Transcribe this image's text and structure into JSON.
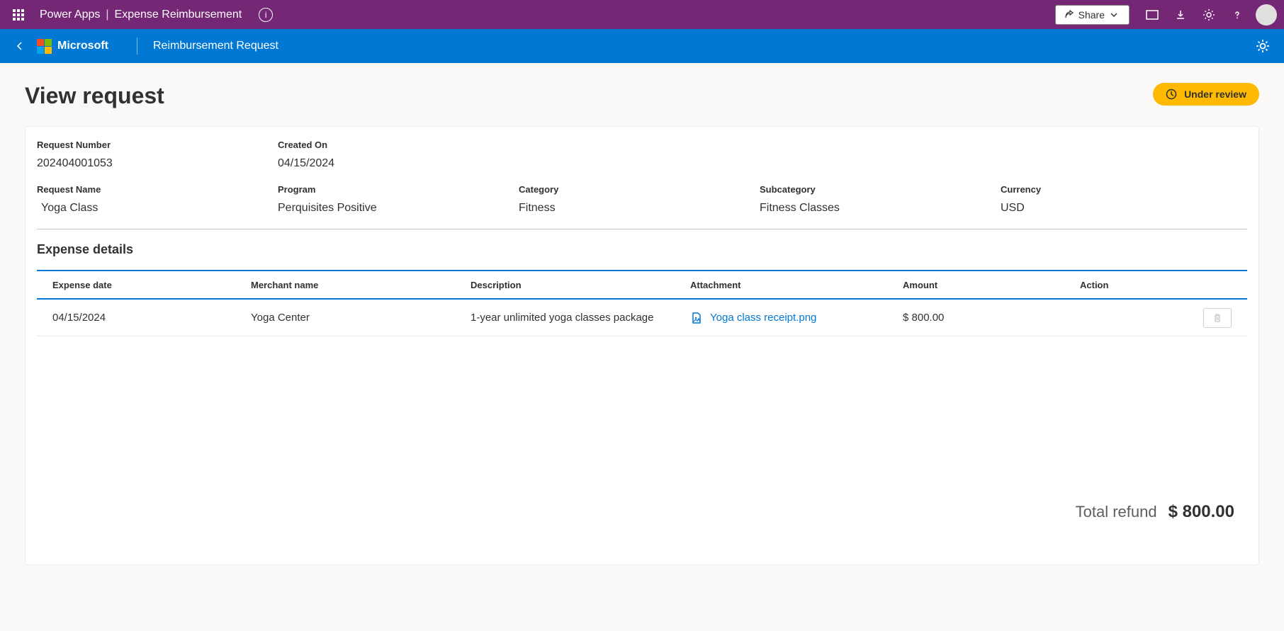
{
  "topBar": {
    "appLabel": "Power Apps",
    "separator": "|",
    "pageLabel": "Expense Reimbursement",
    "shareLabel": "Share"
  },
  "appBar": {
    "brand": "Microsoft",
    "title": "Reimbursement Request"
  },
  "page": {
    "title": "View request",
    "status": "Under review"
  },
  "request": {
    "numberLabel": "Request Number",
    "number": "202404001053",
    "createdOnLabel": "Created On",
    "createdOn": "04/15/2024",
    "nameLabel": "Request Name",
    "name": "Yoga Class",
    "programLabel": "Program",
    "program": "Perquisites Positive",
    "categoryLabel": "Category",
    "category": "Fitness",
    "subcategoryLabel": "Subcategory",
    "subcategory": "Fitness Classes",
    "currencyLabel": "Currency",
    "currency": "USD"
  },
  "expense": {
    "sectionTitle": "Expense details",
    "headers": {
      "date": "Expense date",
      "merchant": "Merchant name",
      "description": "Description",
      "attachment": "Attachment",
      "amount": "Amount",
      "action": "Action"
    },
    "row": {
      "date": "04/15/2024",
      "merchant": "Yoga Center",
      "description": "1-year unlimited yoga classes package",
      "attachment": "Yoga class receipt.png",
      "amount": "$ 800.00"
    }
  },
  "total": {
    "label": "Total refund",
    "value": "$ 800.00"
  }
}
